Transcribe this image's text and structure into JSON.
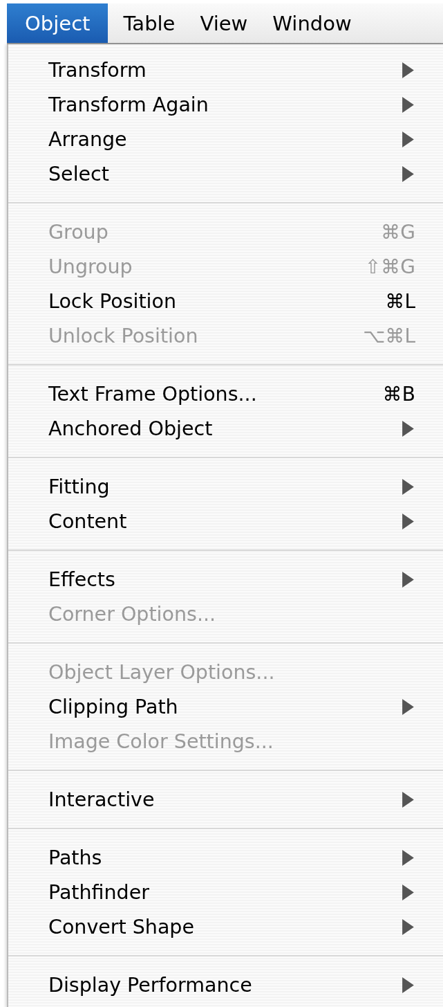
{
  "menubar": [
    {
      "label": "Object",
      "selected": true
    },
    {
      "label": "Table",
      "selected": false
    },
    {
      "label": "View",
      "selected": false
    },
    {
      "label": "Window",
      "selected": false
    }
  ],
  "menu": {
    "groups": [
      [
        {
          "label": "Transform",
          "disabled": false,
          "submenu": true
        },
        {
          "label": "Transform Again",
          "disabled": false,
          "submenu": true
        },
        {
          "label": "Arrange",
          "disabled": false,
          "submenu": true
        },
        {
          "label": "Select",
          "disabled": false,
          "submenu": true
        }
      ],
      [
        {
          "label": "Group",
          "disabled": true,
          "submenu": false,
          "shortcut": "⌘G"
        },
        {
          "label": "Ungroup",
          "disabled": true,
          "submenu": false,
          "shortcut": "⇧⌘G"
        },
        {
          "label": "Lock Position",
          "disabled": false,
          "submenu": false,
          "shortcut": "⌘L"
        },
        {
          "label": "Unlock Position",
          "disabled": true,
          "submenu": false,
          "shortcut": "⌥⌘L"
        }
      ],
      [
        {
          "label": "Text Frame Options...",
          "disabled": false,
          "submenu": false,
          "shortcut": "⌘B"
        },
        {
          "label": "Anchored Object",
          "disabled": false,
          "submenu": true
        }
      ],
      [
        {
          "label": "Fitting",
          "disabled": false,
          "submenu": true
        },
        {
          "label": "Content",
          "disabled": false,
          "submenu": true
        }
      ],
      [
        {
          "label": "Effects",
          "disabled": false,
          "submenu": true
        },
        {
          "label": "Corner Options...",
          "disabled": true,
          "submenu": false
        }
      ],
      [
        {
          "label": "Object Layer Options...",
          "disabled": true,
          "submenu": false
        },
        {
          "label": "Clipping Path",
          "disabled": false,
          "submenu": true
        },
        {
          "label": "Image Color Settings...",
          "disabled": true,
          "submenu": false
        }
      ],
      [
        {
          "label": "Interactive",
          "disabled": false,
          "submenu": true
        }
      ],
      [
        {
          "label": "Paths",
          "disabled": false,
          "submenu": true
        },
        {
          "label": "Pathfinder",
          "disabled": false,
          "submenu": true
        },
        {
          "label": "Convert Shape",
          "disabled": false,
          "submenu": true
        }
      ],
      [
        {
          "label": "Display Performance",
          "disabled": false,
          "submenu": true
        }
      ]
    ]
  }
}
